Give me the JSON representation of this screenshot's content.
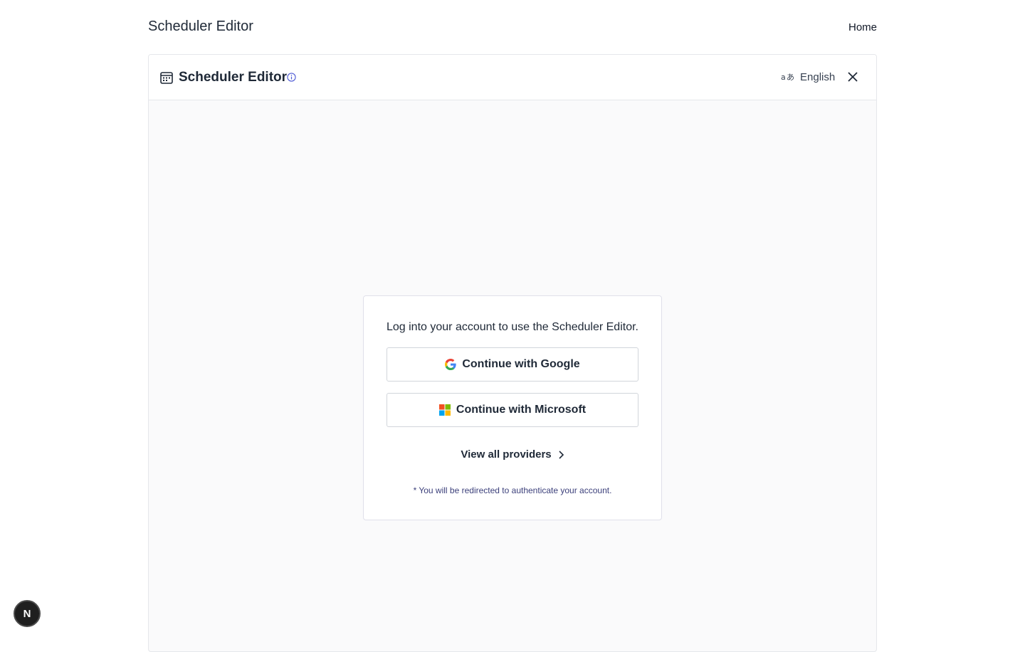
{
  "header": {
    "app_title": "Scheduler Editor",
    "home_link": "Home"
  },
  "panel": {
    "title": "Scheduler Editor",
    "language": "English"
  },
  "login": {
    "message": "Log into your account to use the Scheduler Editor.",
    "google_label": "Continue with Google",
    "microsoft_label": "Continue with Microsoft",
    "view_all_label": "View all providers",
    "note": "* You will be redirected to authenticate your account."
  },
  "badge": {
    "letter": "N"
  },
  "icons": {
    "calendar": "calendar-icon",
    "info": "info-icon",
    "language": "translate-icon",
    "close": "close-icon",
    "google": "google-logo-icon",
    "microsoft": "microsoft-logo-icon",
    "chevron": "chevron-right-icon"
  },
  "colors": {
    "google_blue": "#4285F4",
    "google_red": "#EA4335",
    "google_yellow": "#FBBC05",
    "google_green": "#34A853",
    "ms_red": "#F25022",
    "ms_green": "#7FBA00",
    "ms_blue": "#00A4EF",
    "ms_yellow": "#FFB900"
  }
}
